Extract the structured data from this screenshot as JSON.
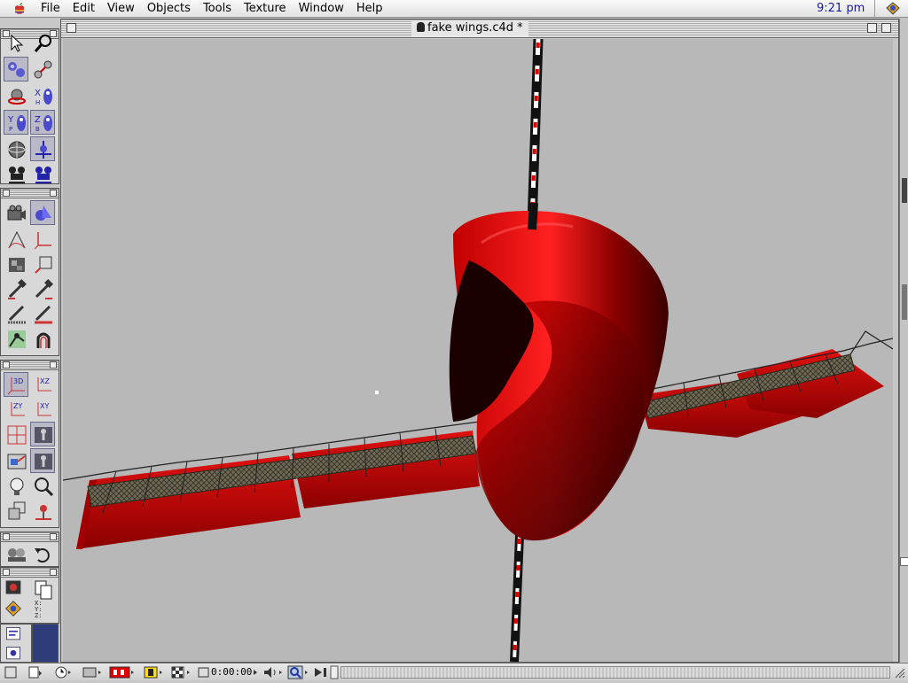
{
  "menubar": {
    "menus": [
      "File",
      "Edit",
      "View",
      "Objects",
      "Tools",
      "Texture",
      "Window",
      "Help"
    ],
    "clock": "9:21 pm"
  },
  "window": {
    "title": "fake wings.c4d *"
  },
  "palettes": {
    "view_tools": {
      "plane_labels": [
        "3D",
        "XZ",
        "ZY",
        "XY"
      ]
    },
    "coords_labels": [
      "X:",
      "Y:",
      "Z:"
    ]
  },
  "bottom_bar": {
    "timecode": "0:00:00"
  },
  "colors": {
    "model_red": "#e00000",
    "viewport_bg": "#b8b8b8",
    "selection_blue": "#2f3c7a"
  }
}
